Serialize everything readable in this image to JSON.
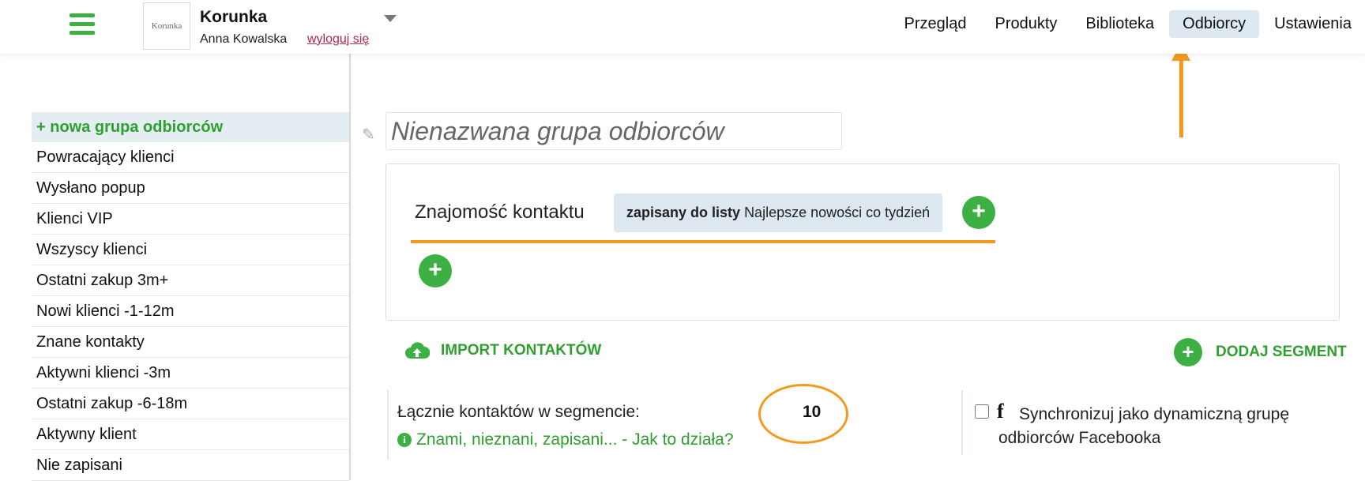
{
  "header": {
    "logo_text": "Korunka",
    "account_name": "Korunka",
    "user_name": "Anna Kowalska",
    "logout_label": "wyloguj się",
    "nav": [
      {
        "label": "Przegląd",
        "active": false
      },
      {
        "label": "Produkty",
        "active": false
      },
      {
        "label": "Biblioteka",
        "active": false
      },
      {
        "label": "Odbiorcy",
        "active": true
      },
      {
        "label": "Ustawienia",
        "active": false
      }
    ]
  },
  "sidebar": {
    "new_group_label": "+ nowa grupa odbiorców",
    "items": [
      {
        "label": "Powracający klienci"
      },
      {
        "label": "Wysłano popup"
      },
      {
        "label": "Klienci VIP"
      },
      {
        "label": "Wszyscy klienci"
      },
      {
        "label": "Ostatni zakup 3m+"
      },
      {
        "label": "Nowi klienci -1-12m"
      },
      {
        "label": "Znane kontakty"
      },
      {
        "label": "Aktywni klienci -3m"
      },
      {
        "label": "Ostatni zakup -6-18m"
      },
      {
        "label": "Aktywny klient"
      },
      {
        "label": "Nie zapisani"
      }
    ]
  },
  "group": {
    "title_placeholder": "Nienazwana grupa odbiorców",
    "condition": {
      "label": "Znajomość kontaktu",
      "chip_bold": "zapisany do listy",
      "chip_text": "Najlepsze nowości co tydzień"
    }
  },
  "actions": {
    "import_label": "IMPORT KONTAKTÓW",
    "add_segment_label": "DODAJ SEGMENT"
  },
  "stats": {
    "label": "Łącznie kontaktów w segmencie:",
    "help_text": "Znami, nieznani, zapisani... - Jak to działa?",
    "count": "10"
  },
  "facebook": {
    "sync_label": "Synchronizuj jako dynamiczną grupę odbiorców Facebooka",
    "checked": false
  },
  "colors": {
    "accent_green": "#3cb043",
    "highlight_orange": "#f39a1e",
    "active_tab_bg": "#dde8f0"
  }
}
